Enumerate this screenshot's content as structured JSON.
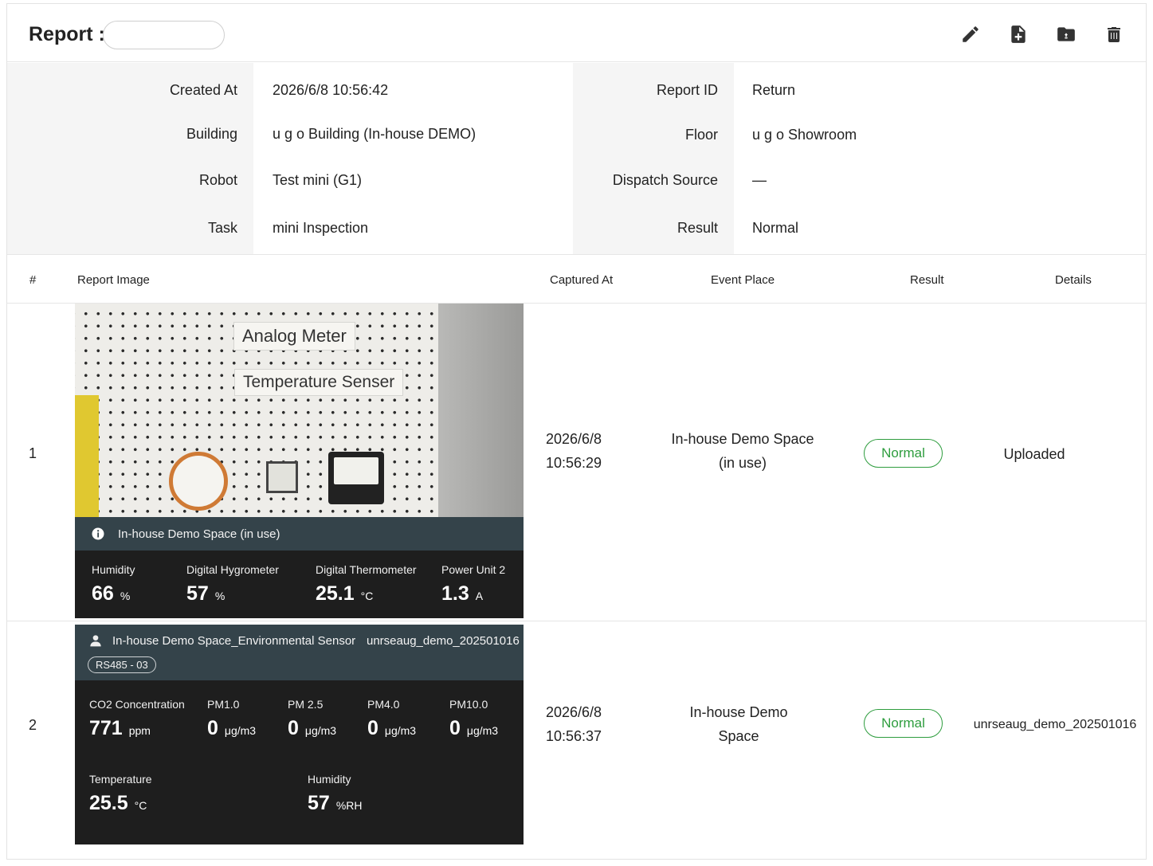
{
  "header": {
    "title": "Report :",
    "name_value": "",
    "actions": [
      {
        "icon": "edit-icon"
      },
      {
        "icon": "add-file-icon"
      },
      {
        "icon": "folder-export-icon"
      },
      {
        "icon": "delete-icon"
      }
    ]
  },
  "info": {
    "left": [
      {
        "label": "Created At",
        "value": "2026/6/8 10:56:42"
      },
      {
        "label": "Building",
        "value": "u g o Building (In-house DEMO)"
      },
      {
        "label": "Robot",
        "value": "Test mini (G1)"
      },
      {
        "label": "Task",
        "value": "mini Inspection"
      }
    ],
    "right": [
      {
        "label": "Report ID",
        "value": "Return"
      },
      {
        "label": "Floor",
        "value": "u g o Showroom"
      },
      {
        "label": "Dispatch Source",
        "value": "—"
      },
      {
        "label": "Result",
        "value": "Normal"
      }
    ]
  },
  "table": {
    "headers": [
      "#",
      "Report Image",
      "Captured At",
      "Event Place",
      "Result",
      "Details"
    ],
    "rows": [
      {
        "index": "1",
        "captured_date": "2026/6/8",
        "captured_time": "10:56:29",
        "place_line1": "In-house Demo Space",
        "place_line2": "(in use)",
        "result": "Normal",
        "details": "Uploaded",
        "image": {
          "signs": [
            "Analog Meter",
            "Temperature Senser"
          ],
          "caption": "In-house Demo Space (in use)",
          "metrics": [
            {
              "label": "Humidity",
              "value": "66",
              "unit": "%"
            },
            {
              "label": "Digital Hygrometer",
              "value": "57",
              "unit": "%"
            },
            {
              "label": "Digital Thermometer",
              "value": "25.1",
              "unit": "°C"
            },
            {
              "label": "Power Unit 2",
              "value": "1.3",
              "unit": "A"
            }
          ]
        }
      },
      {
        "index": "2",
        "captured_date": "2026/6/8",
        "captured_time": "10:56:37",
        "place_line1": "In-house Demo",
        "place_line2": "Space",
        "result": "Normal",
        "details": "unrseaug_demo_202501016",
        "image": {
          "sensor_name": "In-house Demo Space_Environmental Sensor",
          "device_id": "unrseaug_demo_202501016",
          "tag": "RS485 - 03",
          "metrics": [
            {
              "label": "CO2 Concentration",
              "value": "771",
              "unit": "ppm"
            },
            {
              "label": "PM1.0",
              "value": "0",
              "unit": "μg/m3"
            },
            {
              "label": "PM 2.5",
              "value": "0",
              "unit": "μg/m3"
            },
            {
              "label": "PM4.0",
              "value": "0",
              "unit": "μg/m3"
            },
            {
              "label": "PM10.0",
              "value": "0",
              "unit": "μg/m3"
            },
            {
              "label": "Temperature",
              "value": "25.5",
              "unit": "°C"
            },
            {
              "label": "Humidity",
              "value": "57",
              "unit": "%RH"
            }
          ]
        }
      }
    ]
  },
  "colors": {
    "badge_green": "#2e9d3e",
    "caption_bg": "#34434a",
    "sensor_bg": "#1e1e1e",
    "label_bg": "#f5f5f5"
  }
}
